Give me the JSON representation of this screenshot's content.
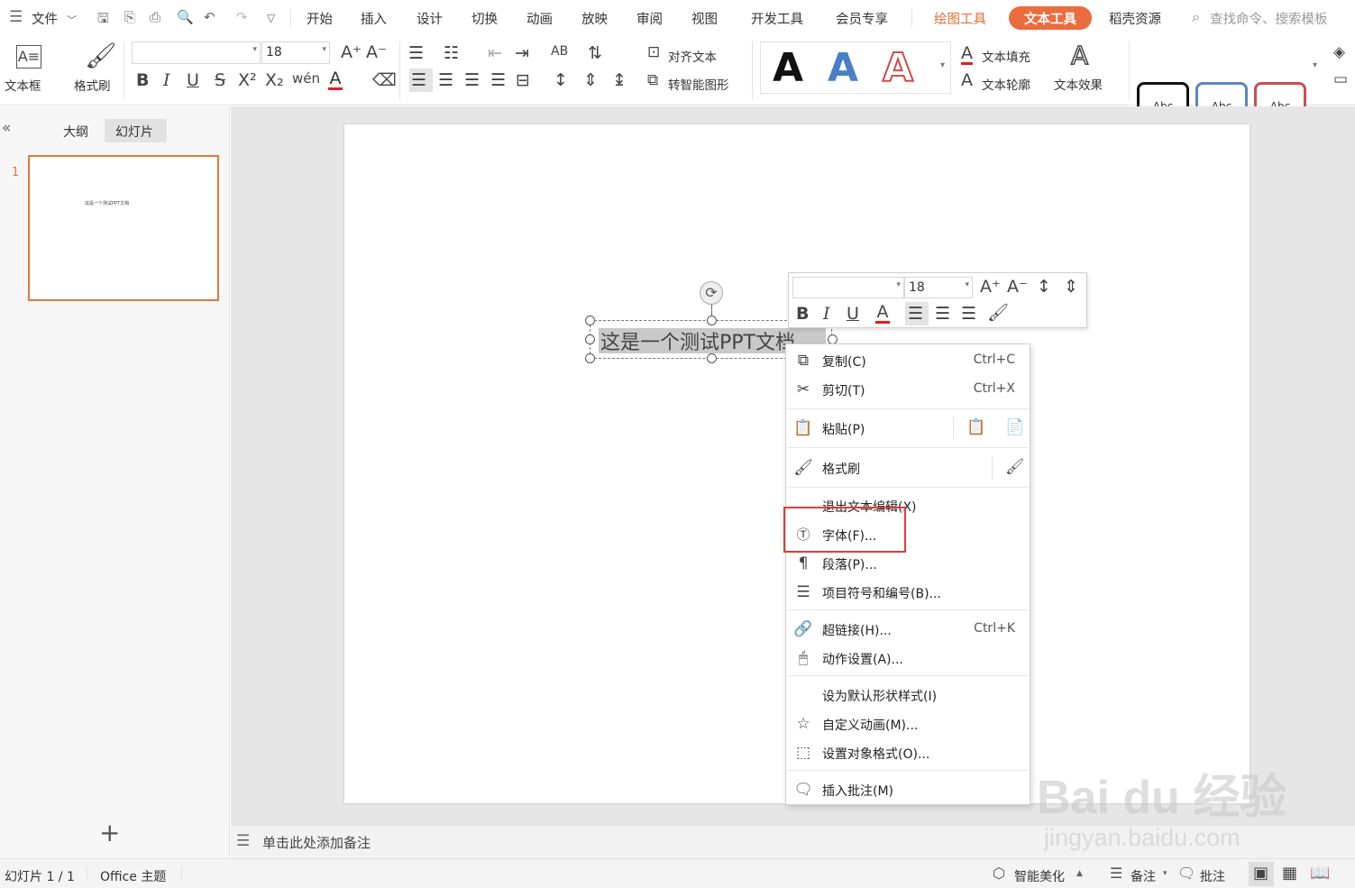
{
  "menubar": {
    "file_label": "文件",
    "tabs": [
      "开始",
      "插入",
      "设计",
      "切换",
      "动画",
      "放映",
      "审阅",
      "视图",
      "开发工具",
      "会员专享"
    ],
    "drawing_tools": "绘图工具",
    "text_tools": "文本工具",
    "resources": "稻壳资源",
    "search_placeholder": "查找命令、搜索模板"
  },
  "ribbon": {
    "textbox_label": "文本框",
    "format_painter_label": "格式刷",
    "font_name": "",
    "font_size": "18",
    "align_text_label": "对齐文本",
    "smart_shape_label": "转智能图形",
    "text_fill_label": "文本填充",
    "text_outline_label": "文本轮廓",
    "text_effect_label": "文本效果",
    "style_letter": "A",
    "abc_label": "Abc"
  },
  "sidebar": {
    "tab_outline": "大纲",
    "tab_slides": "幻灯片",
    "slide_number": "1",
    "thumb_text": "这是一个测试PPT文档"
  },
  "slide": {
    "text_box_content": "这是一个测试PPT文档"
  },
  "mini_toolbar": {
    "font_name": "",
    "font_size": "18"
  },
  "context_menu": {
    "items": [
      {
        "label": "复制(C)",
        "shortcut": "Ctrl+C"
      },
      {
        "label": "剪切(T)",
        "shortcut": "Ctrl+X"
      },
      {
        "label": "粘贴(P)",
        "shortcut": ""
      },
      {
        "label": "格式刷",
        "shortcut": ""
      },
      {
        "label": "退出文本编辑(X)",
        "shortcut": ""
      },
      {
        "label": "字体(F)...",
        "shortcut": ""
      },
      {
        "label": "段落(P)...",
        "shortcut": ""
      },
      {
        "label": "项目符号和编号(B)...",
        "shortcut": ""
      },
      {
        "label": "超链接(H)...",
        "shortcut": "Ctrl+K"
      },
      {
        "label": "动作设置(A)...",
        "shortcut": ""
      },
      {
        "label": "设为默认形状样式(I)",
        "shortcut": ""
      },
      {
        "label": "自定义动画(M)...",
        "shortcut": ""
      },
      {
        "label": "设置对象格式(O)...",
        "shortcut": ""
      },
      {
        "label": "插入批注(M)",
        "shortcut": ""
      }
    ]
  },
  "notes": {
    "placeholder": "单击此处添加备注"
  },
  "statusbar": {
    "slide_info": "幻灯片 1 / 1",
    "theme": "Office 主题",
    "smart_beautify": "智能美化",
    "notes": "备注",
    "comments": "批注"
  },
  "watermark": {
    "logo_text": "Bai du 经验",
    "url": "jingyan.baidu.com"
  },
  "colors": {
    "accent": "#ea6d3e",
    "highlight_box": "#e03c3c",
    "thumb_border": "#e07a3c"
  }
}
